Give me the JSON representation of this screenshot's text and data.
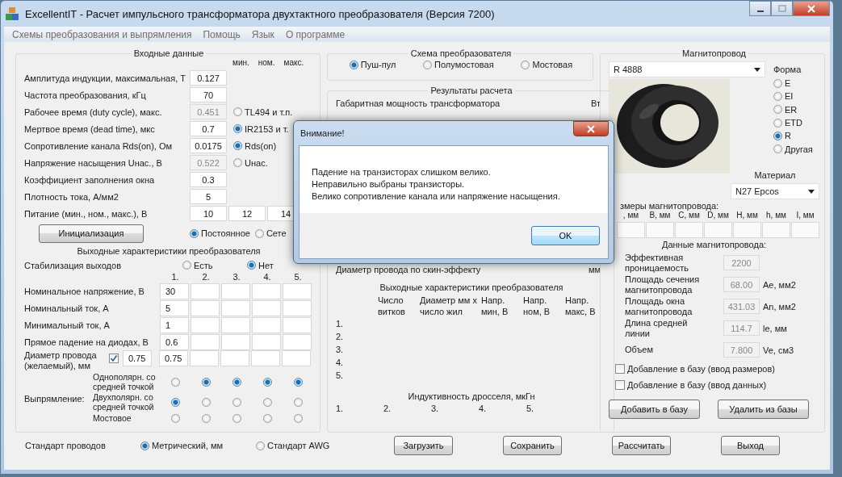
{
  "window": {
    "title": "ExcellentIT - Расчет импульсного трансформатора двухтактного преобразователя (Версия 7200)"
  },
  "menu": [
    "Схемы преобразования и выпрямления",
    "Помощь",
    "Язык",
    "О программе"
  ],
  "input_data": {
    "title": "Входные данные",
    "range_headers": [
      "мин.",
      "ном.",
      "макс."
    ],
    "rows": [
      {
        "label": "Амплитуда индукции, максимальная, Т",
        "value": "0.127",
        "disabled": false
      },
      {
        "label": "Частота преобразования, кГц",
        "value": "70",
        "disabled": false
      },
      {
        "label": "Рабочее время (duty cycle), макс.",
        "value": "0.451",
        "disabled": true,
        "option": {
          "label": "TL494 и т.п.",
          "selected": false
        }
      },
      {
        "label": "Мертвое время (dead time), мкс",
        "value": "0.7",
        "disabled": false,
        "option": {
          "label": "IR2153 и т.",
          "selected": true
        }
      },
      {
        "label": "Сопротивление канала Rds(on), Ом",
        "value": "0.0175",
        "disabled": false,
        "option": {
          "label": "Rds(on)",
          "selected": true
        }
      },
      {
        "label": "Напряжение насыщения Uнас., В",
        "value": "0.522",
        "disabled": true,
        "option": {
          "label": "Uнас.",
          "selected": false
        }
      },
      {
        "label": "Коэффициент заполнения окна",
        "value": "0.3",
        "disabled": false
      },
      {
        "label": "Плотность тока, А/мм2",
        "value": "5",
        "disabled": false
      }
    ],
    "supply": {
      "label": "Питание (мин., ном., макс.), В",
      "values": [
        "10",
        "12",
        "14"
      ]
    },
    "init_button": "Инициализация",
    "current_type": [
      {
        "label": "Постоянное",
        "selected": true
      },
      {
        "label": "Сете",
        "selected": false
      }
    ]
  },
  "outputs": {
    "title": "Выходные характеристики преобразователя",
    "stabilization": {
      "label": "Стабилизация выходов",
      "options": [
        {
          "label": "Есть",
          "selected": false
        },
        {
          "label": "Нет",
          "selected": true
        }
      ]
    },
    "columns": [
      "1.",
      "2.",
      "3.",
      "4.",
      "5."
    ],
    "rows": [
      {
        "label": "Номинальное напряжение, В",
        "values": [
          "30"
        ]
      },
      {
        "label": "Номинальный ток, А",
        "values": [
          "5"
        ]
      },
      {
        "label": "Минимальный ток, А",
        "values": [
          "1"
        ]
      },
      {
        "label": "Прямое падение на диодах, В",
        "values": [
          "0.6"
        ]
      }
    ],
    "wire": {
      "label": "Диаметр провода (желаемый), мм",
      "checked": true,
      "desired": "0.75",
      "values": [
        "0.75"
      ]
    },
    "rectification": {
      "label": "Выпрямление:",
      "types": [
        {
          "label": "Однополярн. со средней точкой",
          "picks": [
            {
              "selected": false
            },
            {
              "selected": true
            },
            {
              "selected": true
            },
            {
              "selected": true
            },
            {
              "selected": true
            }
          ]
        },
        {
          "label": "Двухполярн. со средней точкой",
          "picks": [
            {
              "selected": true
            },
            {
              "selected": false
            },
            {
              "selected": false
            },
            {
              "selected": false
            },
            {
              "selected": false
            }
          ]
        },
        {
          "label": "Мостовое",
          "picks": [
            {
              "selected": false
            },
            {
              "selected": false
            },
            {
              "selected": false
            },
            {
              "selected": false
            },
            {
              "selected": false
            }
          ]
        }
      ]
    }
  },
  "wire_standard": {
    "label": "Стандарт проводов",
    "options": [
      {
        "label": "Метрический, мм",
        "selected": true
      },
      {
        "label": "Стандарт AWG",
        "selected": false
      }
    ]
  },
  "scheme": {
    "title": "Схема преобразователя",
    "options": [
      {
        "label": "Пуш-пул",
        "selected": true
      },
      {
        "label": "Полумостовая",
        "selected": false
      },
      {
        "label": "Мостовая",
        "selected": false
      }
    ]
  },
  "results": {
    "title": "Результаты расчета",
    "rows": [
      {
        "label": "Габаритная мощность трансформатора",
        "unit": "Вт"
      },
      {
        "label": "Диаметр провода по скин-эффекту",
        "unit": "мм"
      }
    ],
    "windings": {
      "title": "Выходные характеристики преобразователя",
      "columns": [
        "Число витков",
        "Диаметр мм х число жил",
        "Напр. мин, В",
        "Напр. ном, В",
        "Напр. макс, В"
      ],
      "rows": [
        "1.",
        "2.",
        "3.",
        "4.",
        "5."
      ]
    },
    "inductance": {
      "title": "Индуктивность дросселя, мкГн",
      "columns": [
        "1.",
        "2.",
        "3.",
        "4.",
        "5."
      ]
    }
  },
  "core": {
    "title": "Магнитопровод",
    "model": "R 4888",
    "picture": {
      "kind": "picture"
    },
    "shape_label": "Форма",
    "shapes": [
      {
        "label": "E",
        "selected": false
      },
      {
        "label": "EI",
        "selected": false
      },
      {
        "label": "ER",
        "selected": false
      },
      {
        "label": "ETD",
        "selected": false
      },
      {
        "label": "R",
        "selected": true
      },
      {
        "label": "Другая",
        "selected": false
      }
    ],
    "material_label": "Материал",
    "material": "N27 Epcos",
    "dimensions_label": "змеры магнитопровода:",
    "dimension_columns": [
      ", мм",
      "B, мм",
      "C, мм",
      "D, мм",
      "H, мм",
      "h, мм",
      "I, мм"
    ],
    "data_title": "Данные магнитопровода:",
    "data": [
      {
        "label": "Эффективная проницаемость",
        "value": "2200"
      },
      {
        "label": "Площадь сечения магнитопровода",
        "value": "68.00",
        "unit": "Ae, мм2"
      },
      {
        "label": "Площадь окна магнитопровода",
        "value": "431.03",
        "unit": "An, мм2"
      },
      {
        "label": "Длина средней линии",
        "value": "114.7",
        "unit": "le, мм"
      },
      {
        "label": "Объем",
        "value": "7.800",
        "unit": "Ve, см3"
      }
    ],
    "checkboxes": [
      {
        "label": "Добавление в базу (ввод размеров)",
        "checked": false
      },
      {
        "label": "Добавление в базу (ввод данных)",
        "checked": false
      }
    ],
    "buttons": [
      "Добавить в базу",
      "Удалить из базы"
    ]
  },
  "buttons": [
    "Загрузить",
    "Сохранить",
    "Рассчитать",
    "Выход"
  ],
  "dialog": {
    "title": "Внимание!",
    "lines": [
      "Падение на транзисторах слишком велико.",
      "Неправильно выбраны транзисторы.",
      "Велико сопротивление канала или напряжение насыщения."
    ],
    "button": "OK"
  }
}
